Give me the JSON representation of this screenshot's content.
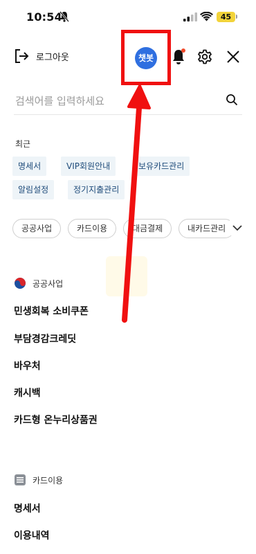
{
  "status": {
    "time": "10:54",
    "battery": "45"
  },
  "header": {
    "logout_label": "로그아웃",
    "chatbot_label": "챗봇"
  },
  "search": {
    "placeholder": "검색어를 입력하세요"
  },
  "recent": {
    "label": "최근",
    "chips": [
      "명세서",
      "VIP회원안내",
      "보유카드관리",
      "알림설정",
      "정기지출관리"
    ]
  },
  "filters": [
    "공공사업",
    "카드이용",
    "대금결제",
    "내카드관리"
  ],
  "sections": [
    {
      "label": "공공사업",
      "items": [
        "민생회복 소비쿠폰",
        "부담경감크레딧",
        "바우처",
        "캐시백",
        "카드형 온누리상품권"
      ]
    },
    {
      "label": "카드이용",
      "items": [
        "명세서",
        "이용내역"
      ]
    }
  ],
  "colors": {
    "accent": "#2f6fe0",
    "highlight": "#f01010",
    "chip_bg": "#eef4f8",
    "chip_text": "#1e4b7a"
  }
}
